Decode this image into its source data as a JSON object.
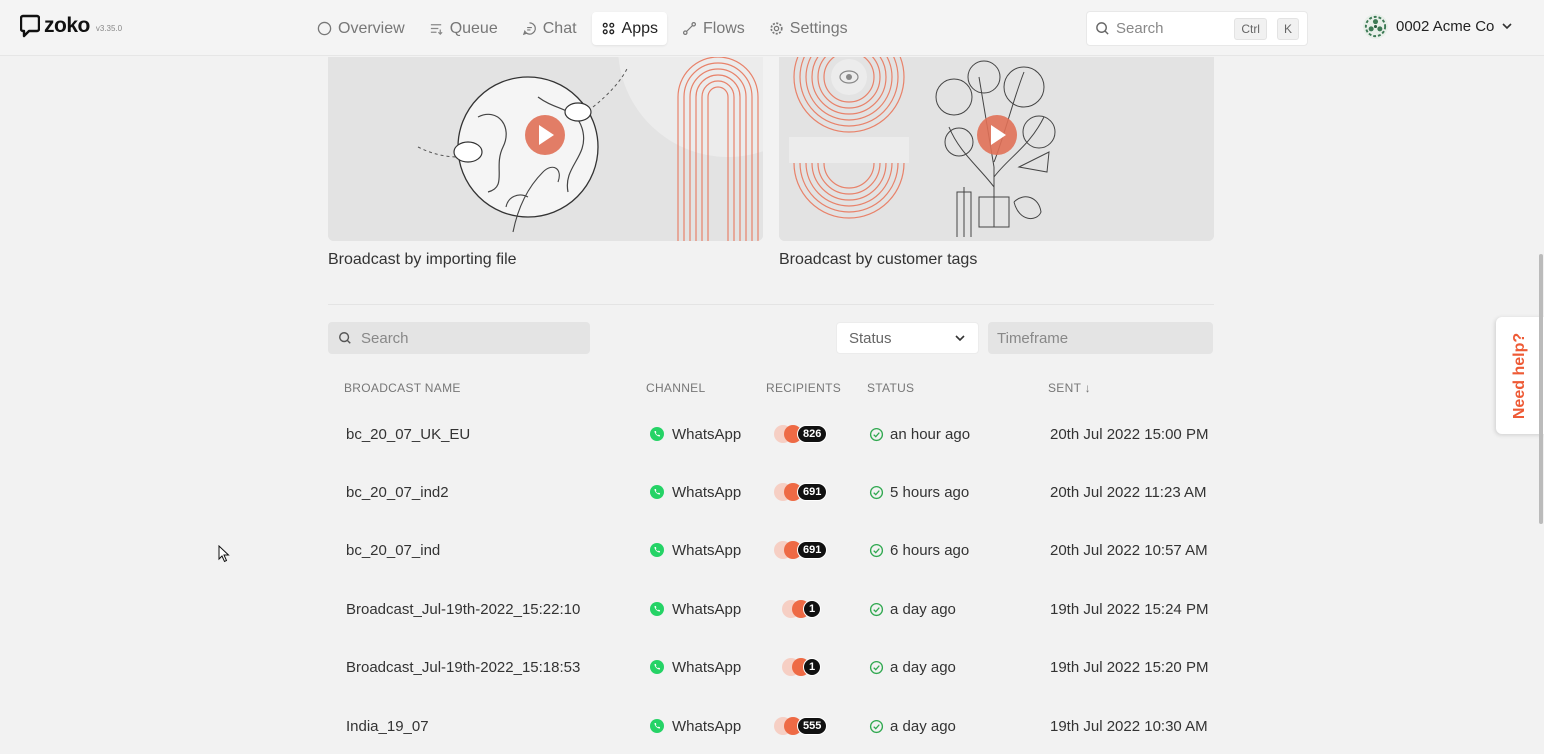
{
  "app": {
    "logo_text": "zoko",
    "version": "v3.35.0"
  },
  "nav": [
    {
      "label": "Overview",
      "icon": "circle-icon",
      "active": false
    },
    {
      "label": "Queue",
      "icon": "queue-icon",
      "active": false
    },
    {
      "label": "Chat",
      "icon": "chat-icon",
      "active": false
    },
    {
      "label": "Apps",
      "icon": "apps-grid-icon",
      "active": true
    },
    {
      "label": "Flows",
      "icon": "flows-icon",
      "active": false
    },
    {
      "label": "Settings",
      "icon": "gear-icon",
      "active": false
    }
  ],
  "global_search": {
    "placeholder": "Search",
    "shortcut_mod": "Ctrl",
    "shortcut_key": "K"
  },
  "account": {
    "name": "0002 Acme Co"
  },
  "cards": [
    {
      "label": "Broadcast by importing file"
    },
    {
      "label": "Broadcast by customer tags"
    }
  ],
  "filters": {
    "search_placeholder": "Search",
    "status_label": "Status",
    "timeframe_placeholder": "Timeframe"
  },
  "table": {
    "headers": {
      "name": "BROADCAST NAME",
      "channel": "CHANNEL",
      "recipients": "RECIPIENTS",
      "status": "STATUS",
      "sent": "SENT ↓"
    },
    "rows": [
      {
        "name": "bc_20_07_UK_EU",
        "channel": "WhatsApp",
        "recipients": "826",
        "status": "an hour ago",
        "sent": "20th Jul 2022 15:00 PM"
      },
      {
        "name": "bc_20_07_ind2",
        "channel": "WhatsApp",
        "recipients": "691",
        "status": "5 hours ago",
        "sent": "20th Jul 2022 11:23 AM"
      },
      {
        "name": "bc_20_07_ind",
        "channel": "WhatsApp",
        "recipients": "691",
        "status": "6 hours ago",
        "sent": "20th Jul 2022 10:57 AM"
      },
      {
        "name": "Broadcast_Jul-19th-2022_15:22:10",
        "channel": "WhatsApp",
        "recipients": "1",
        "status": "a day ago",
        "sent": "19th Jul 2022 15:24 PM"
      },
      {
        "name": "Broadcast_Jul-19th-2022_15:18:53",
        "channel": "WhatsApp",
        "recipients": "1",
        "status": "a day ago",
        "sent": "19th Jul 2022 15:20 PM"
      },
      {
        "name": "India_19_07",
        "channel": "WhatsApp",
        "recipients": "555",
        "status": "a day ago",
        "sent": "19th Jul 2022 10:30 AM"
      }
    ]
  },
  "help": {
    "label": "Need help?"
  },
  "colors": {
    "accent": "#ee5a35",
    "whatsapp": "#25d366",
    "success": "#2fa84f",
    "background": "#f2f2f2"
  }
}
